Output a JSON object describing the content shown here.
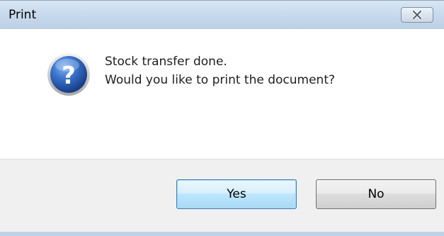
{
  "window": {
    "title": "Print"
  },
  "message": {
    "line1": "Stock transfer done.",
    "line2": "Would you like to print the document?",
    "icon": "question-icon"
  },
  "buttons": {
    "yes_label": "Yes",
    "no_label": "No"
  },
  "titlebar": {
    "close_icon": "close-icon"
  },
  "colors": {
    "titlebar": "#c6d8ec",
    "footer": "#f0f0f0",
    "icon_blue": "#2a63b8",
    "default_button_border": "#3c7fb1"
  }
}
